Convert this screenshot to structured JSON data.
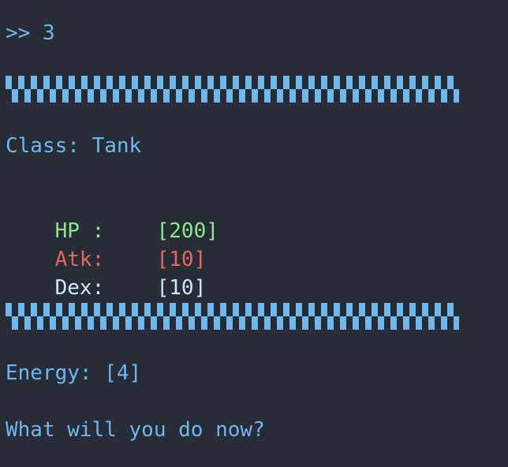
{
  "terminal": {
    "prompt": ">> 3",
    "class_line": "Class: Tank",
    "stats": {
      "hp_label": "HP :",
      "hp_value": "[200]",
      "atk_label": "Atk:",
      "atk_value": "[10]",
      "dex_label": "Dex:",
      "dex_value": "[10]"
    },
    "energy_line": "Energy: [4]",
    "question": "What will you do now?"
  },
  "colors": {
    "background": "#282c37",
    "accent_blue": "#6db8f0",
    "hp_green": "#8ee88e",
    "atk_red": "#e8665c",
    "dex_white": "#cfe9ff"
  }
}
